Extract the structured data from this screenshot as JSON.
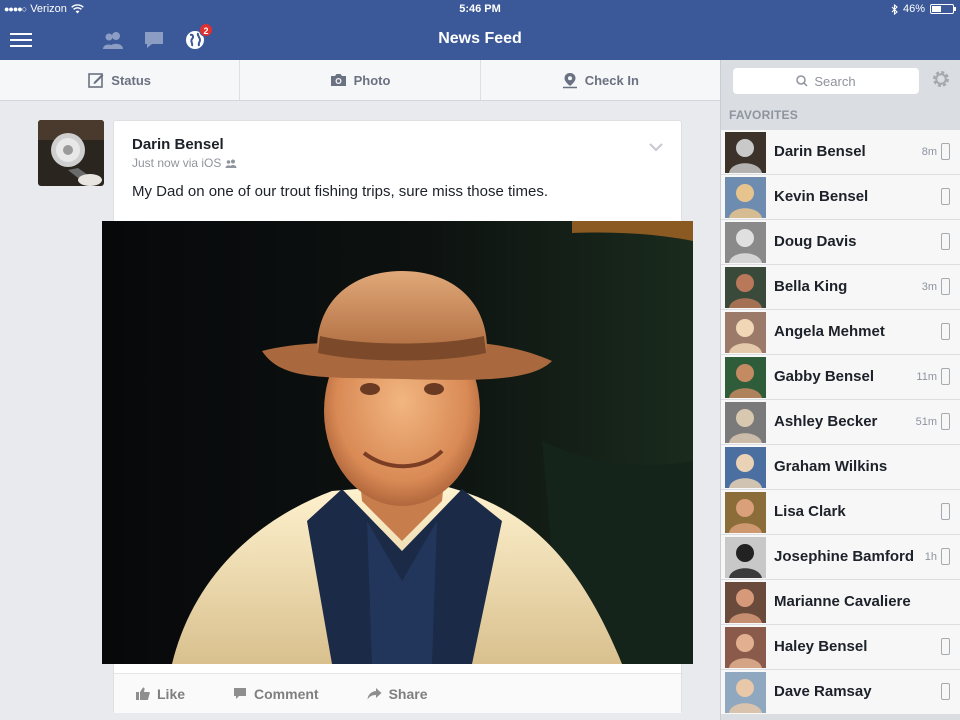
{
  "status_bar": {
    "carrier": "Verizon",
    "time": "5:46 PM",
    "battery": "46%",
    "battery_level": 0.46
  },
  "nav": {
    "title": "News Feed",
    "notification_count": "2",
    "icons": [
      "menu-icon",
      "friend-requests-icon",
      "messages-icon",
      "notifications-globe-icon"
    ]
  },
  "composer": {
    "status_label": "Status",
    "photo_label": "Photo",
    "checkin_label": "Check In"
  },
  "post": {
    "author": "Darin Bensel",
    "meta": "Just now via iOS",
    "text": "My Dad on one of our trout fishing trips, sure miss those times.",
    "like_label": "Like",
    "comment_label": "Comment",
    "share_label": "Share"
  },
  "sidebar": {
    "search_placeholder": "Search",
    "favorites_header": "FAVORITES",
    "friends": [
      {
        "name": "Darin Bensel",
        "time": "8m",
        "mobile": true
      },
      {
        "name": "Kevin Bensel",
        "time": "",
        "mobile": true
      },
      {
        "name": "Doug Davis",
        "time": "",
        "mobile": true
      },
      {
        "name": "Bella King",
        "time": "3m",
        "mobile": true
      },
      {
        "name": "Angela Mehmet",
        "time": "",
        "mobile": true
      },
      {
        "name": "Gabby Bensel",
        "time": "11m",
        "mobile": true
      },
      {
        "name": "Ashley Becker",
        "time": "51m",
        "mobile": true
      },
      {
        "name": "Graham Wilkins",
        "time": "",
        "mobile": false
      },
      {
        "name": "Lisa Clark",
        "time": "",
        "mobile": true
      },
      {
        "name": "Josephine Bamford",
        "time": "1h",
        "mobile": true
      },
      {
        "name": "Marianne Cavaliere",
        "time": "",
        "mobile": false
      },
      {
        "name": "Haley Bensel",
        "time": "",
        "mobile": true
      },
      {
        "name": "Dave Ramsay",
        "time": "",
        "mobile": true
      }
    ]
  },
  "colors": {
    "nav_blue": "#3b5998",
    "badge_red": "#e02f2f",
    "sidebar_bg": "#dadde2",
    "feed_bg": "#e9eaed"
  }
}
